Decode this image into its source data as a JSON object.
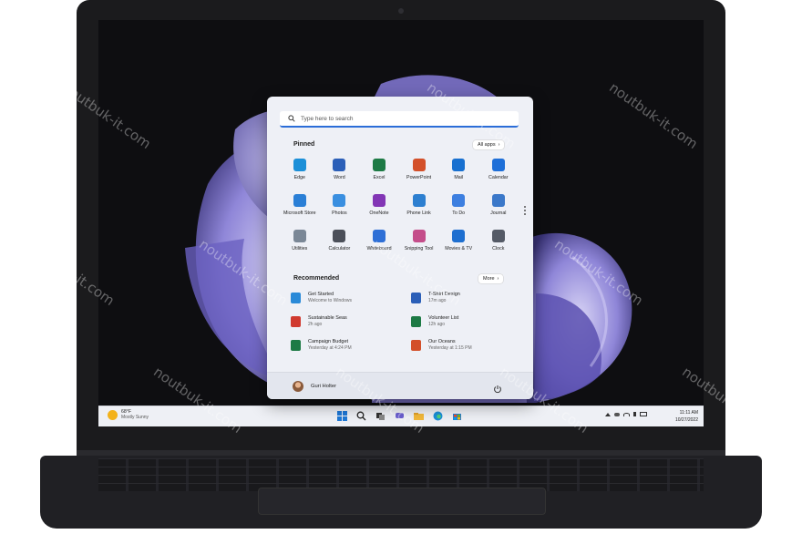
{
  "start_menu": {
    "search_placeholder": "Type here to search",
    "pinned_title": "Pinned",
    "all_apps_label": "All apps",
    "pinned_apps": [
      {
        "label": "Edge",
        "icon": "edge-icon",
        "color": "#1b8fd8"
      },
      {
        "label": "Word",
        "icon": "word-icon",
        "color": "#2b5fb8"
      },
      {
        "label": "Excel",
        "icon": "excel-icon",
        "color": "#1d7a45"
      },
      {
        "label": "PowerPoint",
        "icon": "powerpoint-icon",
        "color": "#d3502a"
      },
      {
        "label": "Mail",
        "icon": "mail-icon",
        "color": "#1870d0"
      },
      {
        "label": "Calendar",
        "icon": "calendar-icon",
        "color": "#1e6fd8"
      },
      {
        "label": "Microsoft Store",
        "icon": "store-icon",
        "color": "#2a7fd6"
      },
      {
        "label": "Photos",
        "icon": "photos-icon",
        "color": "#3a8fe0"
      },
      {
        "label": "OneNote",
        "icon": "onenote-icon",
        "color": "#8236b5"
      },
      {
        "label": "Phone Link",
        "icon": "phone-link-icon",
        "color": "#2d7fd0"
      },
      {
        "label": "To Do",
        "icon": "todo-icon",
        "color": "#3d7fe0"
      },
      {
        "label": "Journal",
        "icon": "journal-icon",
        "color": "#3b78c9"
      },
      {
        "label": "Utilities",
        "icon": "utilities-icon",
        "color": "#7a8796"
      },
      {
        "label": "Calculator",
        "icon": "calculator-icon",
        "color": "#4b4f59"
      },
      {
        "label": "Whiteboard",
        "icon": "whiteboard-icon",
        "color": "#2e6fd6"
      },
      {
        "label": "Snipping Tool",
        "icon": "snipping-tool-icon",
        "color": "#c44d8a"
      },
      {
        "label": "Movies & TV",
        "icon": "movies-tv-icon",
        "color": "#1e6fd0"
      },
      {
        "label": "Clock",
        "icon": "clock-icon",
        "color": "#545a66"
      }
    ],
    "recommended_title": "Recommended",
    "more_label": "More",
    "recommended": [
      {
        "title": "Get Started",
        "sub": "Welcome to Windows",
        "icon": "get-started-icon",
        "color": "#2a8ad8"
      },
      {
        "title": "T-Shirt Design",
        "sub": "17m ago",
        "icon": "word-doc-icon",
        "color": "#2b5fb8"
      },
      {
        "title": "Sustainable Seas",
        "sub": "2h ago",
        "icon": "pdf-icon",
        "color": "#d03a2f"
      },
      {
        "title": "Volunteer List",
        "sub": "12h ago",
        "icon": "excel-doc-icon",
        "color": "#1d7a45"
      },
      {
        "title": "Campaign Budget",
        "sub": "Yesterday at 4:24 PM",
        "icon": "excel-doc-icon",
        "color": "#1d7a45"
      },
      {
        "title": "Our Oceans",
        "sub": "Yesterday at 1:15 PM",
        "icon": "powerpoint-doc-icon",
        "color": "#d3502a"
      }
    ],
    "user_name": "Guri Holter"
  },
  "taskbar": {
    "weather_temp": "68°F",
    "weather_desc": "Mostly Sunny",
    "time": "11:11 AM",
    "date": "10/27/2022"
  },
  "watermark": "noutbuk-it.com"
}
